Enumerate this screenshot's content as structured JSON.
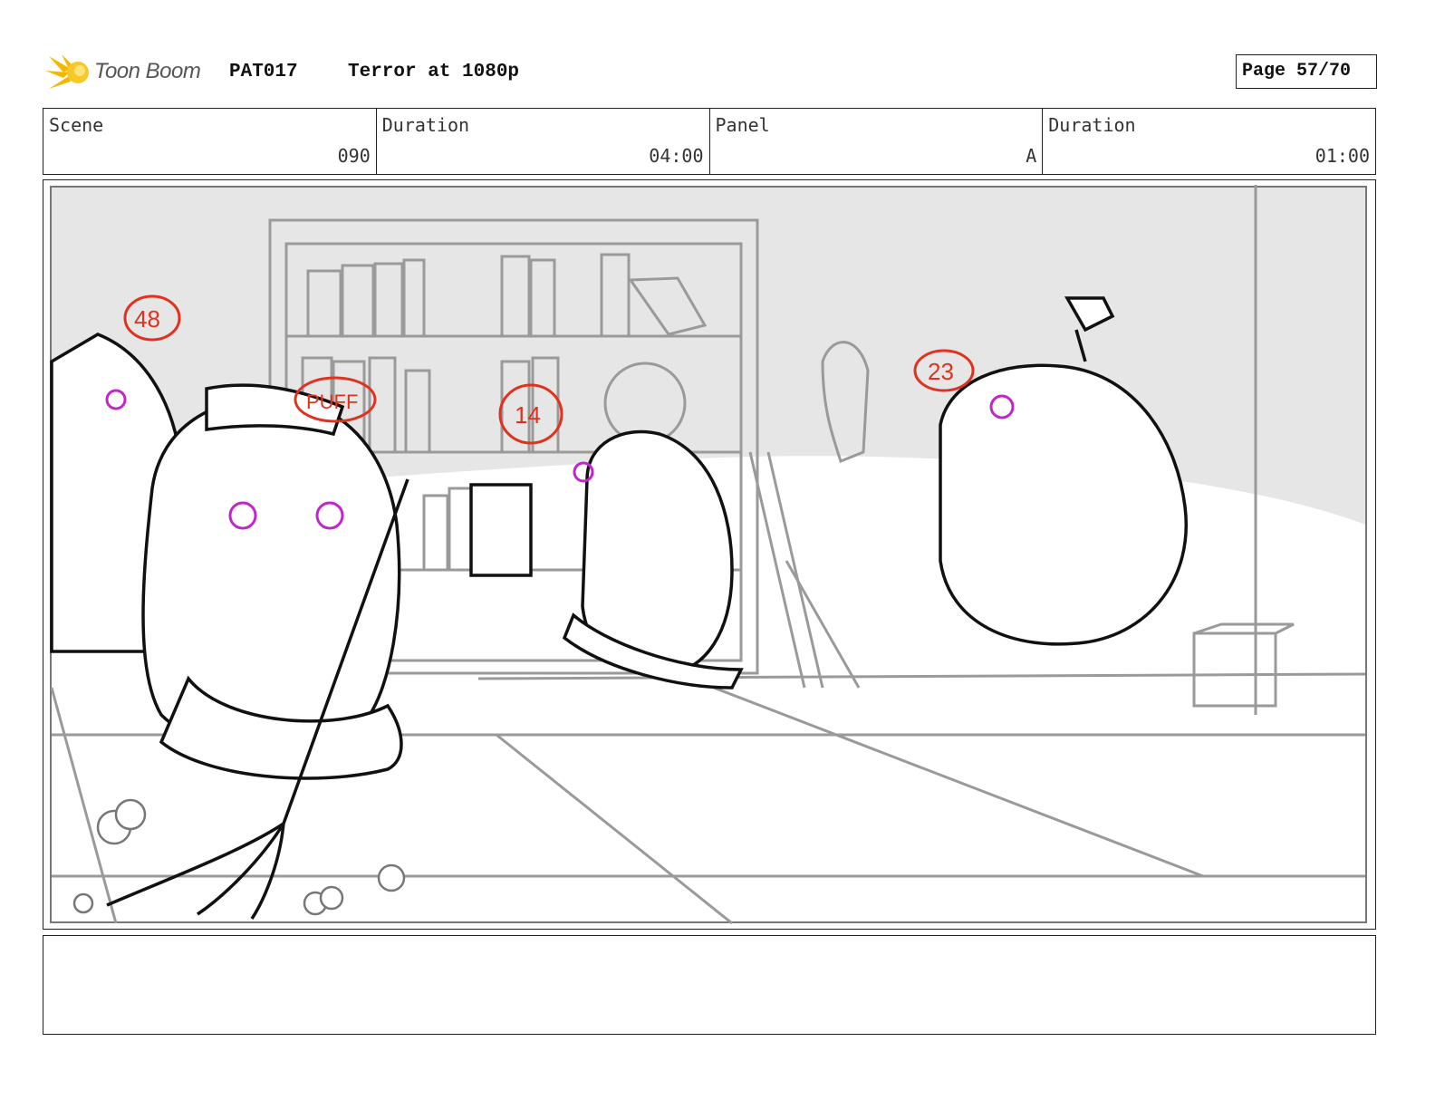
{
  "header": {
    "brand": "Toon Boom",
    "project_code": "PAT017",
    "project_title": "Terror at 1080p",
    "page_label": "Page 57/70"
  },
  "info": {
    "scene_label": "Scene",
    "scene_value": "090",
    "duration_label": "Duration",
    "duration_value": "04:00",
    "panel_label": "Panel",
    "panel_value": "A",
    "panel_duration_label": "Duration",
    "panel_duration_value": "01:00"
  },
  "sketch": {
    "annotations": [
      "48",
      "PUFF",
      "14",
      "23"
    ],
    "annotation_color": "#e0321e",
    "eye_color": "#c026c8",
    "wall_color": "#e6e6e6",
    "line_color": "#111111",
    "bg_line_color": "#9a9a9a"
  },
  "notes": {
    "text": ""
  }
}
